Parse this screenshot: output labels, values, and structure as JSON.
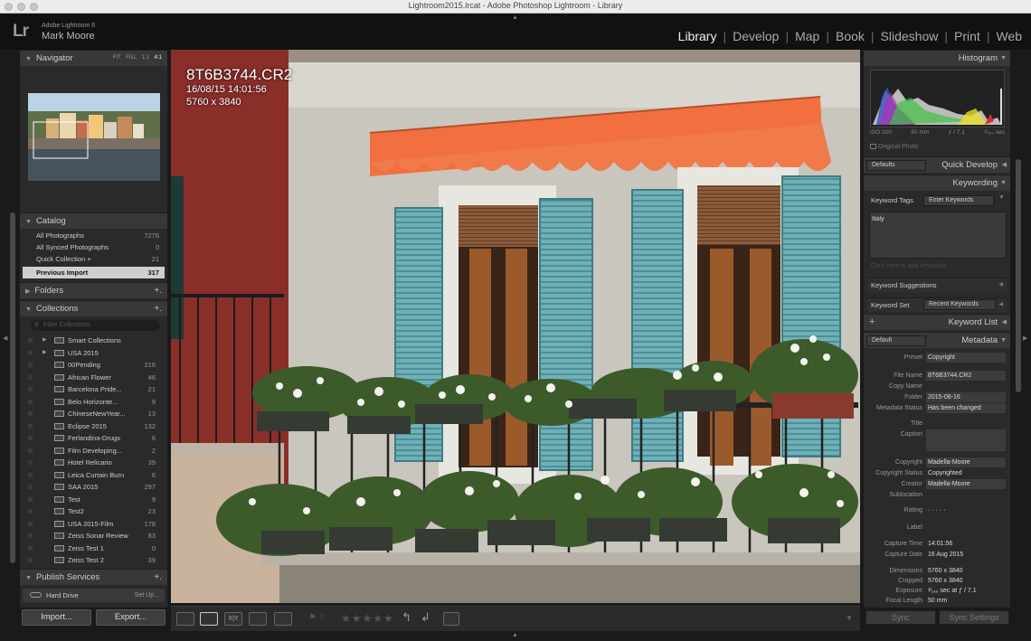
{
  "window": {
    "title": "Lightroom2015.lrcat - Adobe Photoshop Lightroom - Library"
  },
  "identity": {
    "logo": "Lr",
    "product": "Adobe Lightroom 6",
    "user": "Mark Moore"
  },
  "modules": [
    "Library",
    "Develop",
    "Map",
    "Book",
    "Slideshow",
    "Print",
    "Web"
  ],
  "navigator": {
    "title": "Navigator",
    "zoom_options": [
      "FIT",
      "FILL",
      "1:1",
      "4:1"
    ]
  },
  "catalog": {
    "title": "Catalog",
    "items": [
      {
        "label": "All Photographs",
        "count": "7276"
      },
      {
        "label": "All Synced Photographs",
        "count": "0"
      },
      {
        "label": "Quick Collection +",
        "count": "21"
      },
      {
        "label": "Previous Import",
        "count": "317"
      }
    ]
  },
  "folders": {
    "title": "Folders",
    "add": "+."
  },
  "collections": {
    "title": "Collections",
    "add": "+.",
    "filter_placeholder": "Filter Collections",
    "items": [
      {
        "label": "Smart Collections",
        "count": ""
      },
      {
        "label": "USA 2015",
        "count": ""
      },
      {
        "label": "00Pending",
        "count": "216"
      },
      {
        "label": "African Flower",
        "count": "46"
      },
      {
        "label": "Barcelona Pride...",
        "count": "21"
      },
      {
        "label": "Belo Horizonte...",
        "count": "9"
      },
      {
        "label": "ChineseNewYear...",
        "count": "13"
      },
      {
        "label": "Eclipse 2015",
        "count": "132"
      },
      {
        "label": "Ferlandina-Drugs",
        "count": "6"
      },
      {
        "label": "Film Developing...",
        "count": "2"
      },
      {
        "label": "Hotel Relicario",
        "count": "39"
      },
      {
        "label": "Leica Curtain Burn",
        "count": "6"
      },
      {
        "label": "SAA 2015",
        "count": "297"
      },
      {
        "label": "Test",
        "count": "9"
      },
      {
        "label": "Test2",
        "count": "23"
      },
      {
        "label": "USA 2015-Film",
        "count": "178"
      },
      {
        "label": "Zeiss Sonar Review",
        "count": "83"
      },
      {
        "label": "Zeiss Test 1",
        "count": "0"
      },
      {
        "label": "Zeiss Test 2",
        "count": "39"
      }
    ]
  },
  "publish": {
    "title": "Publish Services",
    "add": "+.",
    "service": "Hard Drive",
    "setup": "Set Up..."
  },
  "buttons": {
    "import": "Import...",
    "export": "Export...",
    "sync": "Sync",
    "sync_settings": "Sync Settings"
  },
  "photo_info": {
    "filename": "8T6B3744.CR2",
    "datetime": "16/08/15 14:01:56",
    "dimensions": "5760 x 3840"
  },
  "histogram": {
    "title": "Histogram",
    "iso": "ISO 320",
    "focal": "50 mm",
    "aperture": "ƒ / 7.1",
    "shutter": "¹⁄₁₆₀ sec",
    "original": "Original Photo"
  },
  "quick_develop": {
    "title": "Quick Develop",
    "preset": "Defaults"
  },
  "keywording": {
    "title": "Keywording",
    "tags_label": "Keyword Tags",
    "tags_mode": "Enter Keywords",
    "keywords": "Italy",
    "add_placeholder": "Click here to add keywords",
    "suggestions": "Keyword Suggestions",
    "set_label": "Keyword Set",
    "set_value": "Recent Keywords"
  },
  "keyword_list": {
    "title": "Keyword List",
    "add": "+"
  },
  "metadata": {
    "title": "Metadata",
    "view": "Default",
    "preset_label": "Preset",
    "preset_value": "Copyright",
    "fields": [
      {
        "label": "File Name",
        "value": "8T6B3744.CR2"
      },
      {
        "label": "Copy Name",
        "value": ""
      },
      {
        "label": "Folder",
        "value": "2015-08-16"
      },
      {
        "label": "Metadata Status",
        "value": "Has been changed"
      },
      {
        "label": "Title",
        "value": ""
      },
      {
        "label": "Caption",
        "value": ""
      },
      {
        "label": "Copyright",
        "value": "Madella-Moore"
      },
      {
        "label": "Copyright Status",
        "value": "Copyrighted"
      },
      {
        "label": "Creator",
        "value": "Madella-Moore"
      },
      {
        "label": "Sublocation",
        "value": ""
      },
      {
        "label": "Rating",
        "value": "· · · · ·"
      },
      {
        "label": "Label",
        "value": ""
      },
      {
        "label": "Capture Time",
        "value": "14:01:56"
      },
      {
        "label": "Capture Date",
        "value": "16 Aug 2015"
      },
      {
        "label": "Dimensions",
        "value": "5760 x 3840"
      },
      {
        "label": "Cropped",
        "value": "5760 x 3840"
      },
      {
        "label": "Exposure",
        "value": "¹⁄₁₆₀ sec at ƒ / 7.1"
      },
      {
        "label": "Focal Length",
        "value": "50 mm"
      }
    ]
  },
  "toolbar": {
    "stars": "★★★★★"
  },
  "colors": {
    "awning": "#f2703f",
    "shutter": "#6fb1b8",
    "wall": "#c9c6bd",
    "red_wall": "#8a2e2a",
    "panel": "#2a2a2a"
  }
}
